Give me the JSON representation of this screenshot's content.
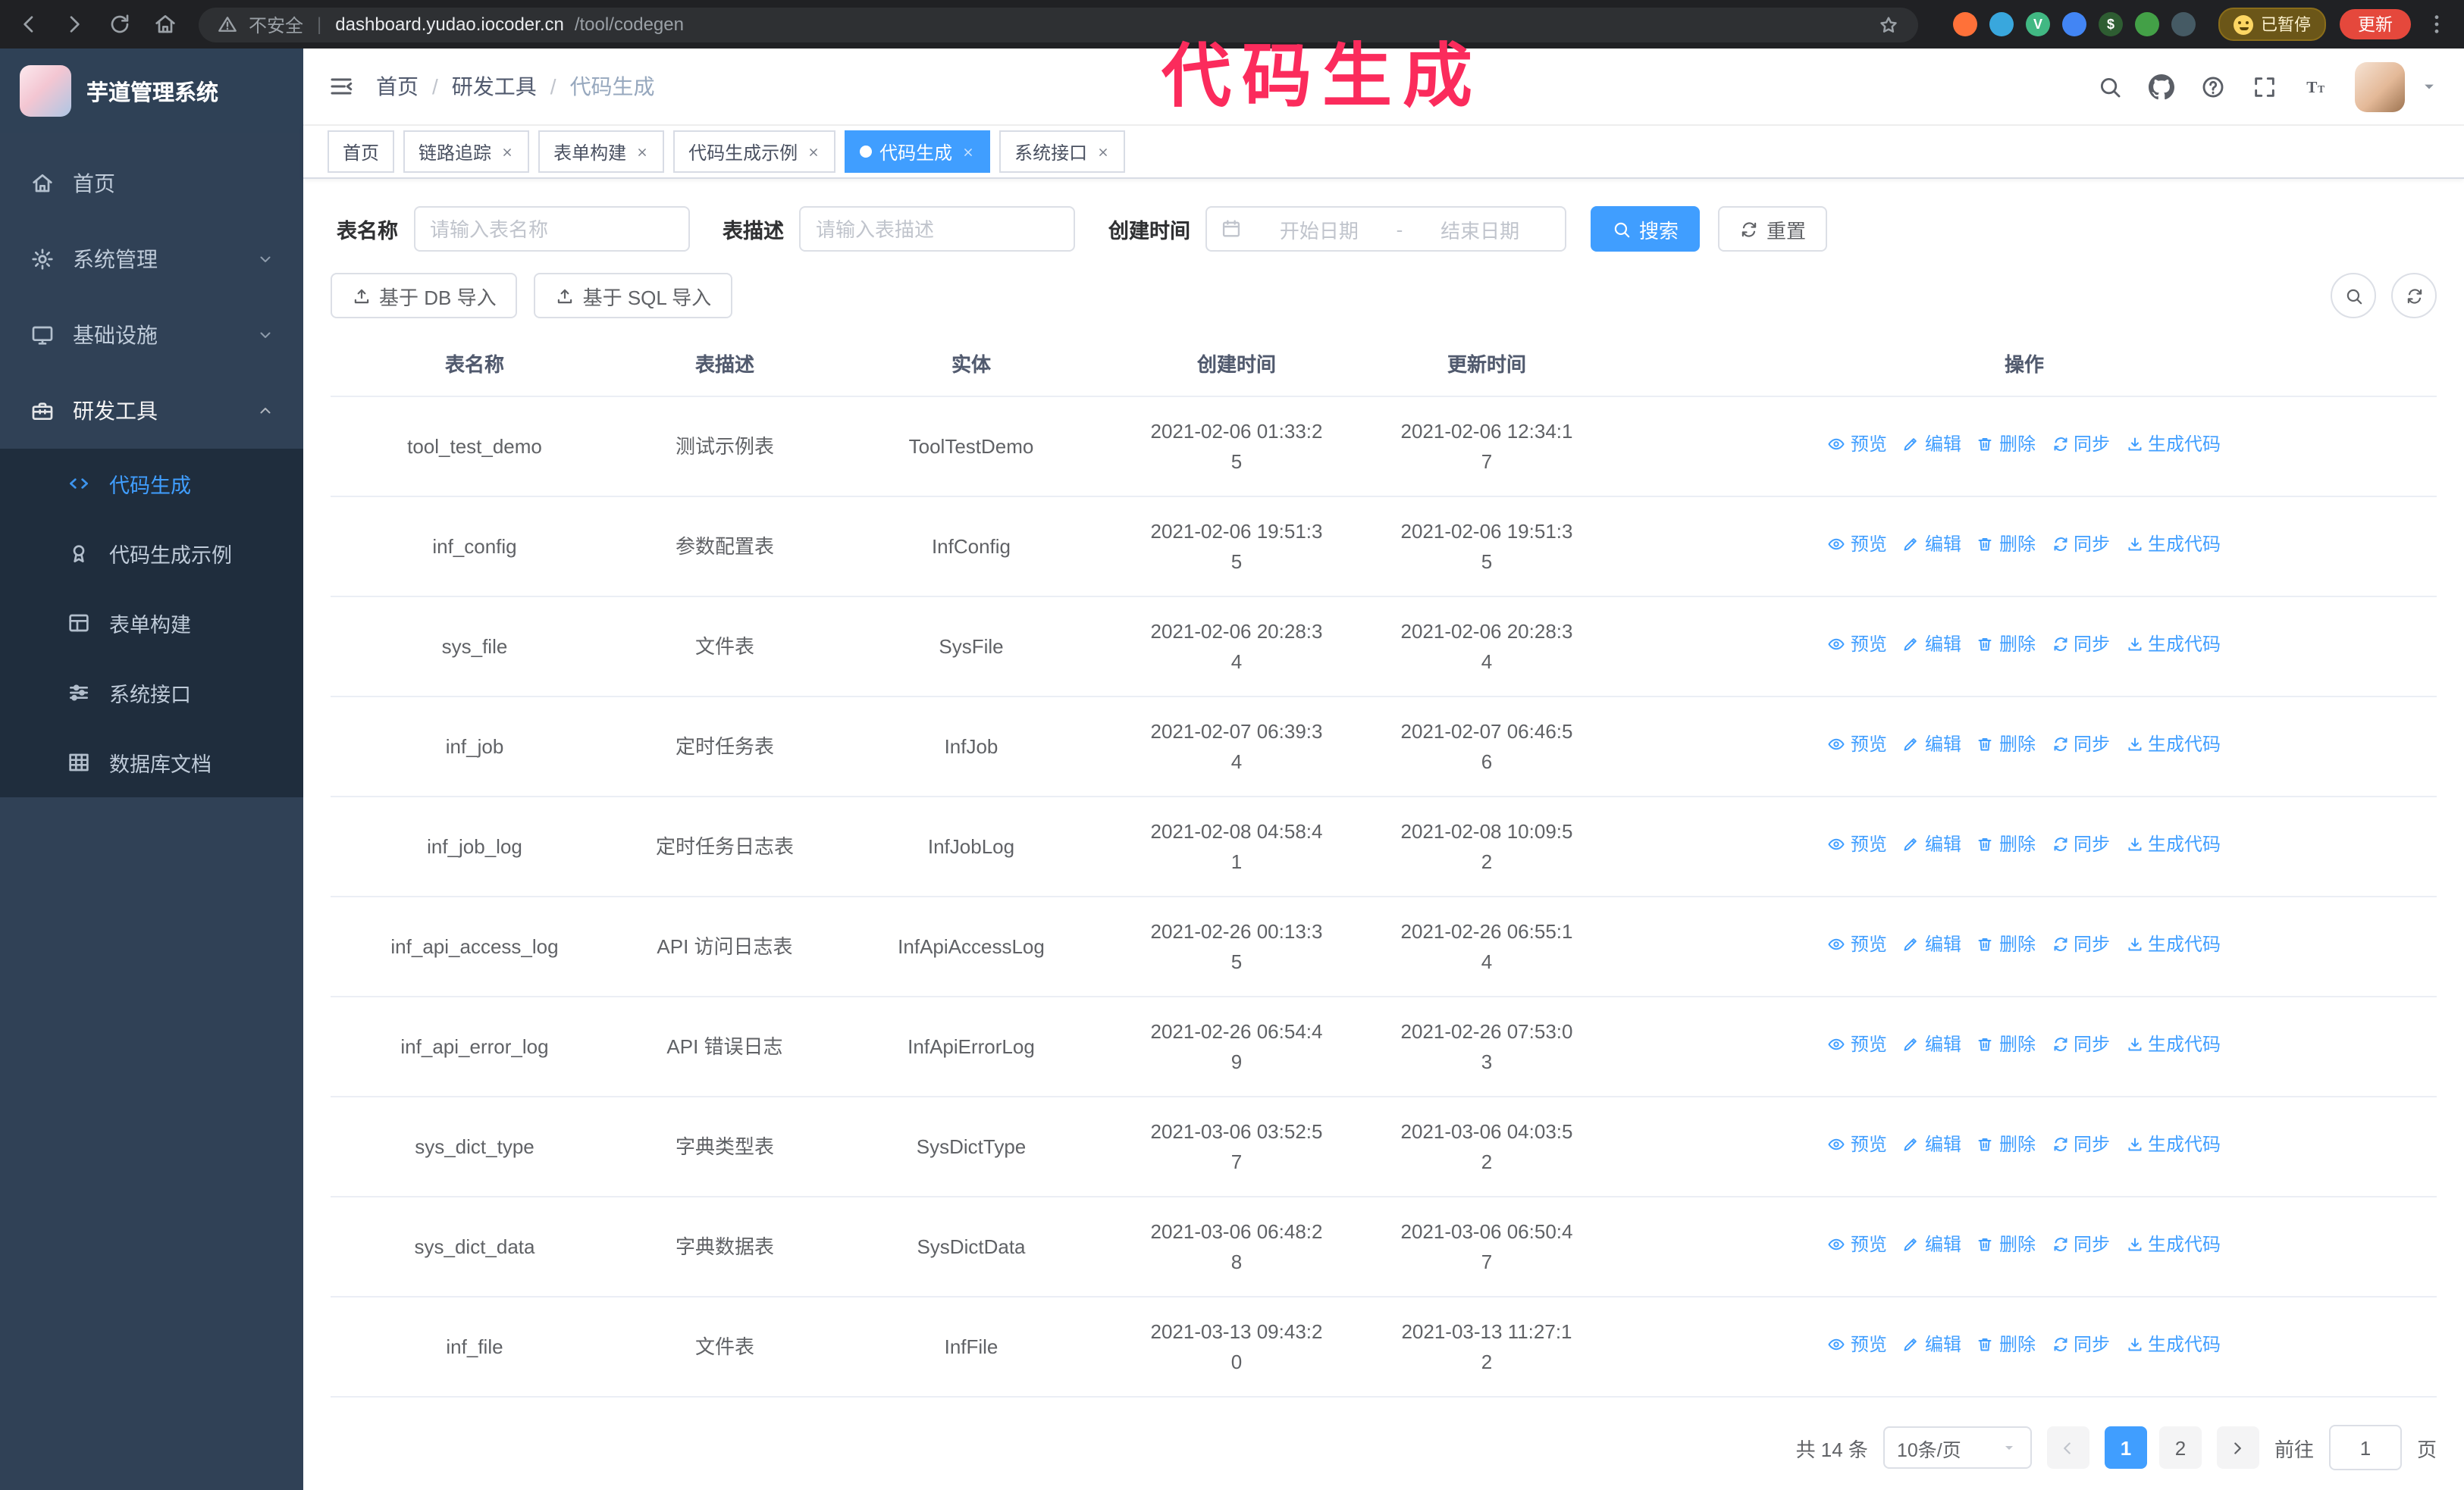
{
  "browser": {
    "nav_icons": [
      "back",
      "forward",
      "reload",
      "home"
    ],
    "security_label": "不安全",
    "divider": "|",
    "url_host": "dashboard.yudao.iocoder.cn",
    "url_path": "/tool/codegen",
    "extensions": [
      {
        "name": "fox-extension-icon",
        "bg": "#ff7139",
        "glyph": ""
      },
      {
        "name": "water-drop-extension-icon",
        "bg": "#39a7dd",
        "glyph": ""
      },
      {
        "name": "vue-devtools-extension-icon",
        "bg": "#41b883",
        "glyph": "V"
      },
      {
        "name": "users-extension-icon",
        "bg": "#4285f4",
        "glyph": ""
      },
      {
        "name": "terminal-extension-icon",
        "bg": "#2e5d32",
        "glyph": "$"
      },
      {
        "name": "leaf-extension-icon",
        "bg": "#43a047",
        "glyph": ""
      },
      {
        "name": "puzzle-extension-icon",
        "bg": "#455a64",
        "glyph": ""
      }
    ],
    "paused_badge": "已暂停",
    "update_button": "更新"
  },
  "annotation": {
    "text": "代码生成"
  },
  "sidebar": {
    "logo_title": "芋道管理系统",
    "items": [
      {
        "id": "home",
        "label": "首页",
        "icon": "home",
        "type": "item"
      },
      {
        "id": "system",
        "label": "系统管理",
        "icon": "gear",
        "type": "group",
        "chevron": "down"
      },
      {
        "id": "infra",
        "label": "基础设施",
        "icon": "monitor",
        "type": "group",
        "chevron": "down"
      },
      {
        "id": "devtools",
        "label": "研发工具",
        "icon": "toolbox",
        "type": "group",
        "chevron": "up",
        "open": true
      },
      {
        "id": "codegen",
        "label": "代码生成",
        "icon": "code",
        "type": "sub",
        "active": true
      },
      {
        "id": "codegen-demo",
        "label": "代码生成示例",
        "icon": "badge",
        "type": "sub"
      },
      {
        "id": "form-builder",
        "label": "表单构建",
        "icon": "form",
        "type": "sub"
      },
      {
        "id": "system-api",
        "label": "系统接口",
        "icon": "sliders",
        "type": "sub"
      },
      {
        "id": "db-doc",
        "label": "数据库文档",
        "icon": "spreadsheet",
        "type": "sub"
      }
    ]
  },
  "navbar": {
    "breadcrumb": [
      "首页",
      "研发工具",
      "代码生成"
    ],
    "icons": [
      "search",
      "github",
      "question",
      "fullscreen",
      "font-size"
    ]
  },
  "tabs": [
    {
      "id": "home",
      "label": "首页",
      "closable": false,
      "active": false
    },
    {
      "id": "trace",
      "label": "链路追踪",
      "closable": true,
      "active": false
    },
    {
      "id": "form-builder",
      "label": "表单构建",
      "closable": true,
      "active": false
    },
    {
      "id": "codegen-demo",
      "label": "代码生成示例",
      "closable": true,
      "active": false
    },
    {
      "id": "codegen",
      "label": "代码生成",
      "closable": true,
      "active": true
    },
    {
      "id": "system-api",
      "label": "系统接口",
      "closable": true,
      "active": false
    }
  ],
  "filters": {
    "table_name_label": "表名称",
    "table_name_placeholder": "请输入表名称",
    "table_desc_label": "表描述",
    "table_desc_placeholder": "请输入表描述",
    "create_time_label": "创建时间",
    "date_start_placeholder": "开始日期",
    "date_separator": "-",
    "date_end_placeholder": "结束日期",
    "search_button": "搜索",
    "reset_button": "重置"
  },
  "toolbar": {
    "import_db_button": "基于 DB 导入",
    "import_sql_button": "基于 SQL 导入"
  },
  "table": {
    "columns": [
      "表名称",
      "表描述",
      "实体",
      "创建时间",
      "更新时间",
      "操作"
    ],
    "actions": [
      {
        "id": "preview",
        "label": "预览",
        "icon": "eye"
      },
      {
        "id": "edit",
        "label": "编辑",
        "icon": "pencil"
      },
      {
        "id": "delete",
        "label": "删除",
        "icon": "trash"
      },
      {
        "id": "sync",
        "label": "同步",
        "icon": "refresh"
      },
      {
        "id": "generate-code",
        "label": "生成代码",
        "icon": "download"
      }
    ],
    "rows": [
      {
        "name": "tool_test_demo",
        "desc": "测试示例表",
        "entity": "ToolTestDemo",
        "created": "2021-02-06 01:33:25",
        "updated": "2021-02-06 12:34:17"
      },
      {
        "name": "inf_config",
        "desc": "参数配置表",
        "entity": "InfConfig",
        "created": "2021-02-06 19:51:35",
        "updated": "2021-02-06 19:51:35"
      },
      {
        "name": "sys_file",
        "desc": "文件表",
        "entity": "SysFile",
        "created": "2021-02-06 20:28:34",
        "updated": "2021-02-06 20:28:34"
      },
      {
        "name": "inf_job",
        "desc": "定时任务表",
        "entity": "InfJob",
        "created": "2021-02-07 06:39:34",
        "updated": "2021-02-07 06:46:56"
      },
      {
        "name": "inf_job_log",
        "desc": "定时任务日志表",
        "entity": "InfJobLog",
        "created": "2021-02-08 04:58:41",
        "updated": "2021-02-08 10:09:52"
      },
      {
        "name": "inf_api_access_log",
        "desc": "API 访问日志表",
        "entity": "InfApiAccessLog",
        "created": "2021-02-26 00:13:35",
        "updated": "2021-02-26 06:55:14"
      },
      {
        "name": "inf_api_error_log",
        "desc": "API 错误日志",
        "entity": "InfApiErrorLog",
        "created": "2021-02-26 06:54:49",
        "updated": "2021-02-26 07:53:03"
      },
      {
        "name": "sys_dict_type",
        "desc": "字典类型表",
        "entity": "SysDictType",
        "created": "2021-03-06 03:52:57",
        "updated": "2021-03-06 04:03:52"
      },
      {
        "name": "sys_dict_data",
        "desc": "字典数据表",
        "entity": "SysDictData",
        "created": "2021-03-06 06:48:28",
        "updated": "2021-03-06 06:50:47"
      },
      {
        "name": "inf_file",
        "desc": "文件表",
        "entity": "InfFile",
        "created": "2021-03-13 09:43:20",
        "updated": "2021-03-13 11:27:12"
      }
    ]
  },
  "pagination": {
    "total_text": "共 14 条",
    "page_size": "10条/页",
    "pages": [
      {
        "id": "1",
        "label": "1",
        "active": true
      },
      {
        "id": "2",
        "label": "2",
        "active": false
      }
    ],
    "goto_label": "前往",
    "goto_value": "1",
    "goto_suffix": "页"
  },
  "colors": {
    "primary": "#409eff",
    "sidebar_bg": "#304156",
    "submenu_bg": "#1f2d3d",
    "annotation": "#fb2b5c",
    "update_button_bg": "#e5483c"
  }
}
